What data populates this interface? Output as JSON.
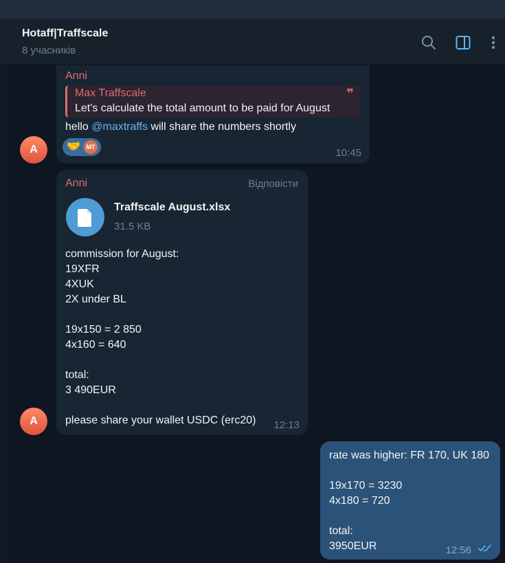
{
  "header": {
    "title": "Hotaff|Traffscale",
    "subtitle": "8 учасників"
  },
  "messages": [
    {
      "sender": "Anni",
      "avatar_letter": "A",
      "quote": {
        "name": "Max Traffscale",
        "text": "Let's calculate the total amount to be paid for August",
        "mark": "❞"
      },
      "text_before": "hello ",
      "mention": "@maxtraffs",
      "text_after": " will share the numbers shortly",
      "reactions": {
        "emoji": "🤝",
        "user_initials": "MT"
      },
      "time": "10:45"
    },
    {
      "sender": "Anni",
      "avatar_letter": "A",
      "reply_label": "Відповісти",
      "file": {
        "name": "Traffscale August.xlsx",
        "size": "31.5 KB"
      },
      "text": "commission for August:\n19XFR\n4XUK\n2X under BL\n\n19x150 = 2 850\n4x160 = 640\n\ntotal:\n3 490EUR\n\nplease share your wallet USDC (erc20)",
      "time": "12:13"
    },
    {
      "outgoing": true,
      "text": "rate was higher: FR 170, UK 180\n\n19x170 = 3230\n4x180 = 720\n\ntotal:\n3950EUR",
      "time": "12:56",
      "status": "read"
    }
  ],
  "icons": {
    "search": "search-icon",
    "sidebar_toggle": "sidebar-toggle-icon",
    "more": "more-vertical-icon"
  },
  "colors": {
    "background": "#0e1621",
    "incoming_bubble": "#182533",
    "outgoing_bubble": "#2b5278",
    "sender_name": "#e06c6c",
    "link": "#6ab3f3",
    "accent": "#5eb5f7"
  }
}
